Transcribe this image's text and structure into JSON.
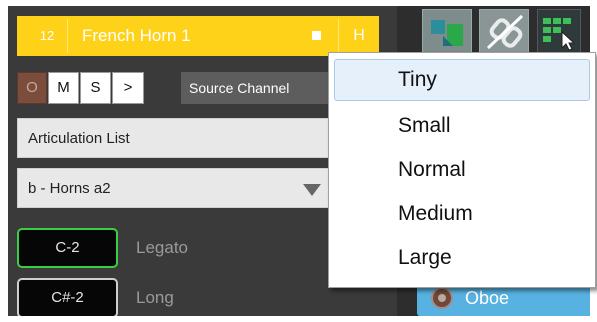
{
  "track": {
    "number": "12",
    "name": "French Horn 1",
    "h_label": "H"
  },
  "buttons": {
    "o": "O",
    "m": "M",
    "s": "S",
    "gt": ">",
    "source_channel": "Source Channel"
  },
  "articulation": {
    "list_label": "Articulation List",
    "selected": "b - Horns a2",
    "items": [
      {
        "key": "C-2",
        "label": "Legato"
      },
      {
        "key": "C#-2",
        "label": "Long"
      }
    ]
  },
  "toolbar": {
    "icons": [
      "arrange-icon",
      "unlink-icon",
      "grid-pointer-icon"
    ]
  },
  "track_item": {
    "label": "Oboe"
  },
  "size_menu": {
    "options": [
      "Tiny",
      "Small",
      "Normal",
      "Medium",
      "Large"
    ],
    "highlighted": "Tiny"
  },
  "colors": {
    "track_header": "#ffd21a",
    "active_key_border": "#3ccd48",
    "oboe_track": "#57b2e1",
    "menu_highlight": "#e6f0fb"
  }
}
